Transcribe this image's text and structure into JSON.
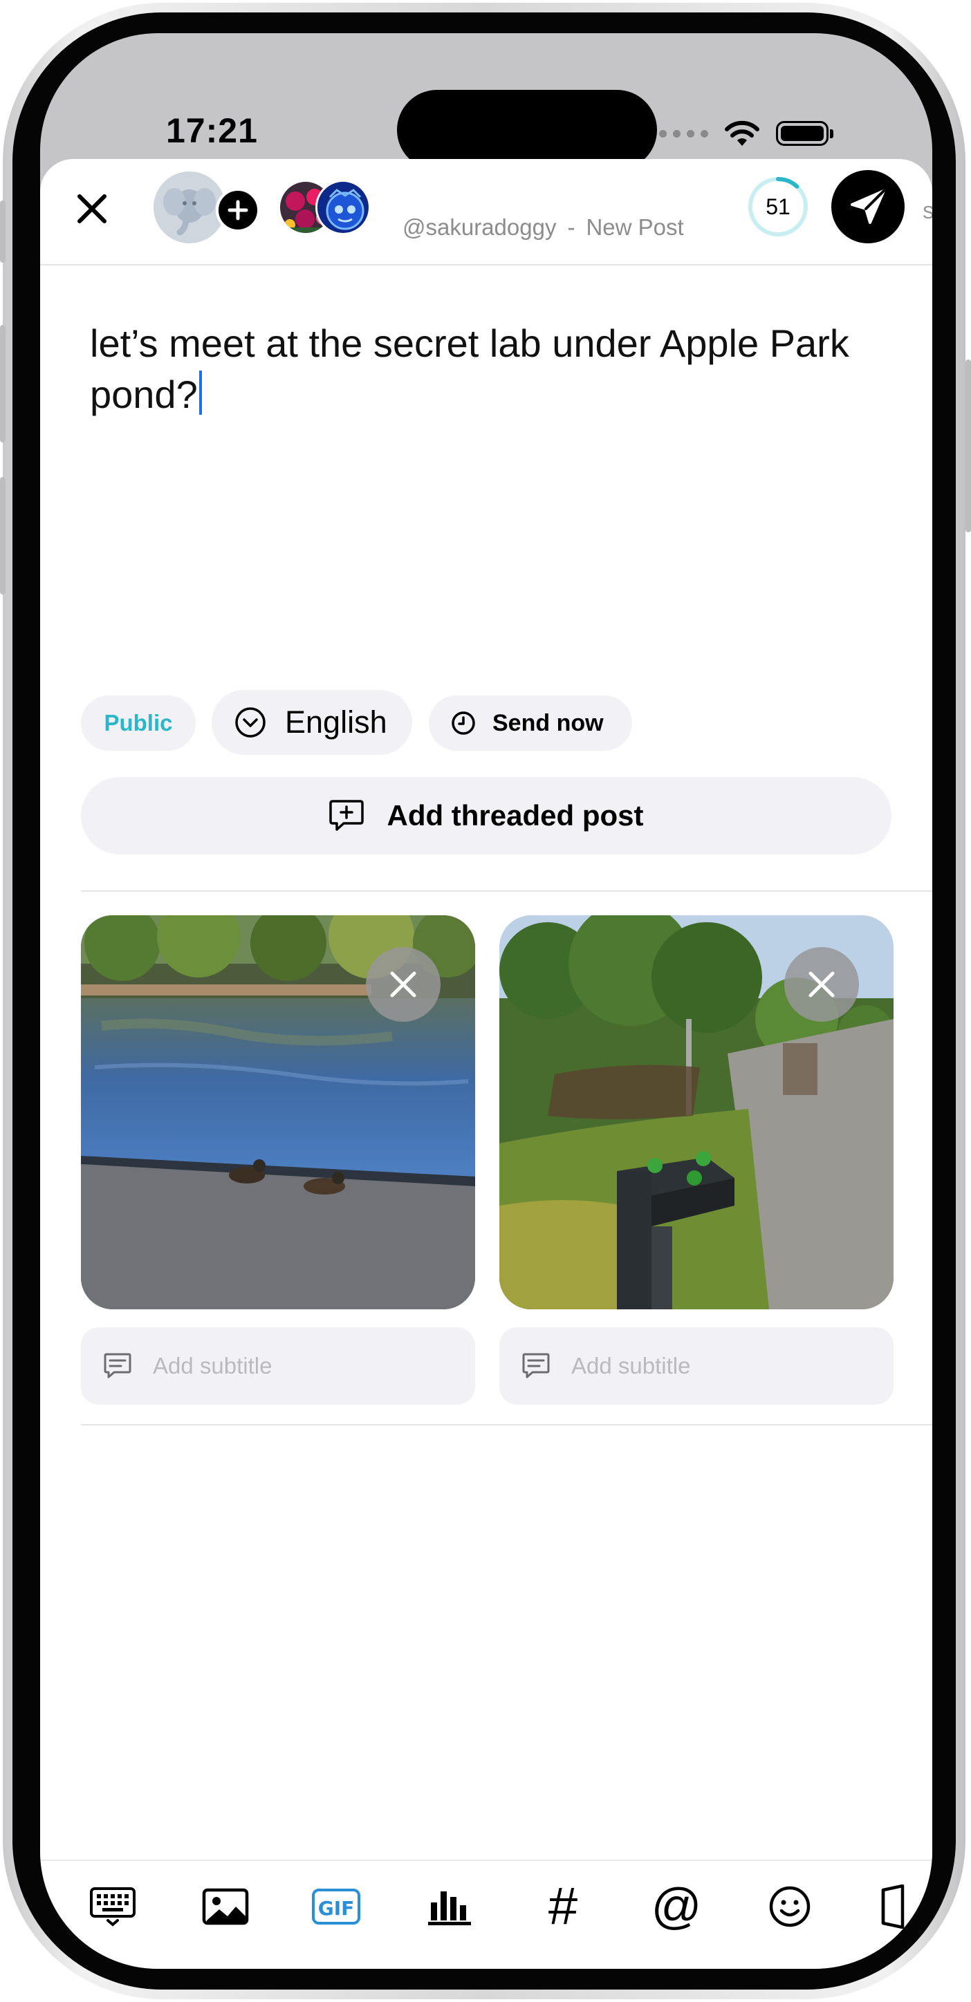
{
  "status_bar": {
    "time": "17:21"
  },
  "header": {
    "handle": "@sakuradoggy",
    "separator": "-",
    "title": "New Post",
    "char_remaining": "51",
    "char_fraction_used": 0.12,
    "edge_char": "s"
  },
  "composer": {
    "text": "let’s meet at the secret lab under Apple Park pond?"
  },
  "options": {
    "visibility": "Public",
    "language": "English",
    "schedule": "Send now"
  },
  "thread_button": "Add threaded post",
  "media": [
    {
      "alt": "pond with ducks",
      "subtitle_placeholder": "Add subtitle"
    },
    {
      "alt": "apple orchard path",
      "subtitle_placeholder": "Add subtitle"
    }
  ],
  "toolbar": [
    "keyboard-icon",
    "image-icon",
    "gif-icon",
    "poll-icon",
    "hashtag-icon",
    "mention-icon",
    "emoji-icon",
    "content-warning-icon"
  ],
  "colors": {
    "accent": "#2bb7c9",
    "caret": "#1a73e8",
    "gif": "#2a8fd6"
  }
}
